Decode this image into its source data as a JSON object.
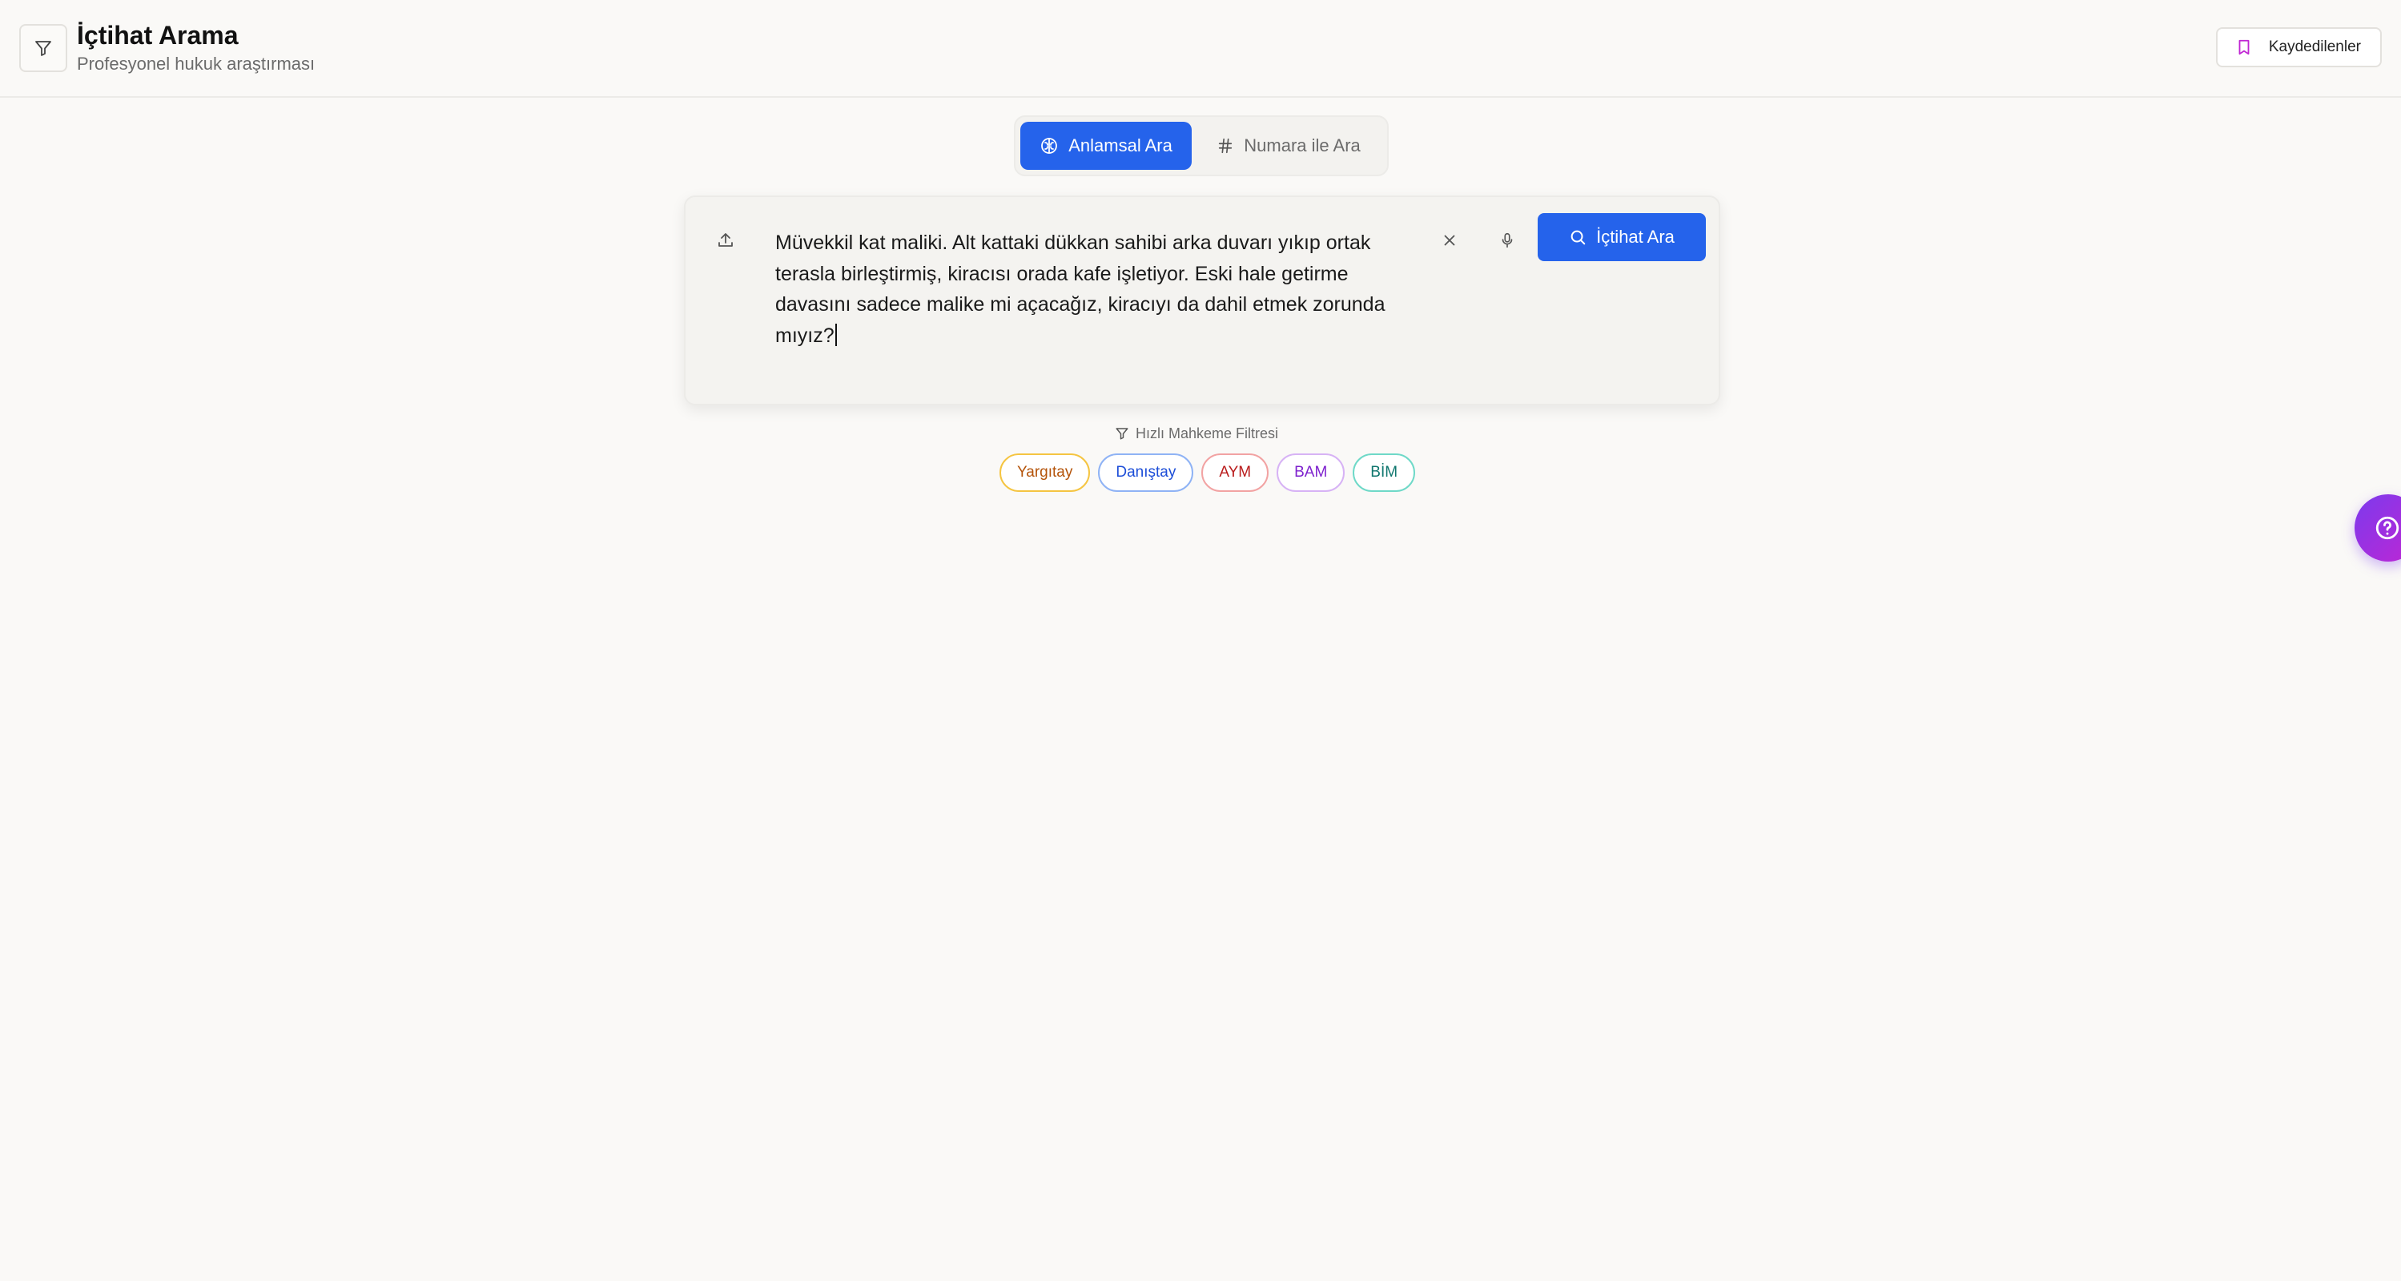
{
  "header": {
    "title": "İçtihat Arama",
    "subtitle": "Profesyonel hukuk araştırması",
    "saved_label": "Kaydedilenler"
  },
  "tabs": [
    {
      "label": "Anlamsal Ara",
      "active": true
    },
    {
      "label": "Numara ile Ara",
      "active": false
    }
  ],
  "search": {
    "query": "Müvekkil kat maliki. Alt kattaki dükkan sahibi arka duvarı yıkıp ortak terasla birleştirmiş, kiracısı orada kafe işletiyor. Eski hale getirme davasını sadece malike mi açacağız, kiracıyı da dahil etmek zorunda mıyız?",
    "button_label": "İçtihat Ara"
  },
  "quick_filter": {
    "label": "Hızlı Mahkeme Filtresi",
    "chips": [
      {
        "label": "Yargıtay",
        "color": "#b45309",
        "border": "#f5c542"
      },
      {
        "label": "Danıştay",
        "color": "#1d4ed8",
        "border": "#8fb3f5"
      },
      {
        "label": "AYM",
        "color": "#b91c1c",
        "border": "#f2a3a3"
      },
      {
        "label": "BAM",
        "color": "#7e22ce",
        "border": "#d7b3f5"
      },
      {
        "label": "BİM",
        "color": "#0f766e",
        "border": "#6fd9c8"
      }
    ]
  },
  "colors": {
    "primary": "#2563eb",
    "background": "#faf9f7",
    "saved_icon": "#c026d3",
    "help_gradient_start": "#7c3aed",
    "help_gradient_end": "#c026d3"
  },
  "icons": {
    "filter": "filter-icon",
    "saved": "bookmark-icon",
    "semantic_tab": "brain-icon",
    "number_tab": "hash-icon",
    "upload": "upload-icon",
    "clear": "close-icon",
    "mic": "microphone-icon",
    "search": "search-icon",
    "help": "help-icon"
  }
}
